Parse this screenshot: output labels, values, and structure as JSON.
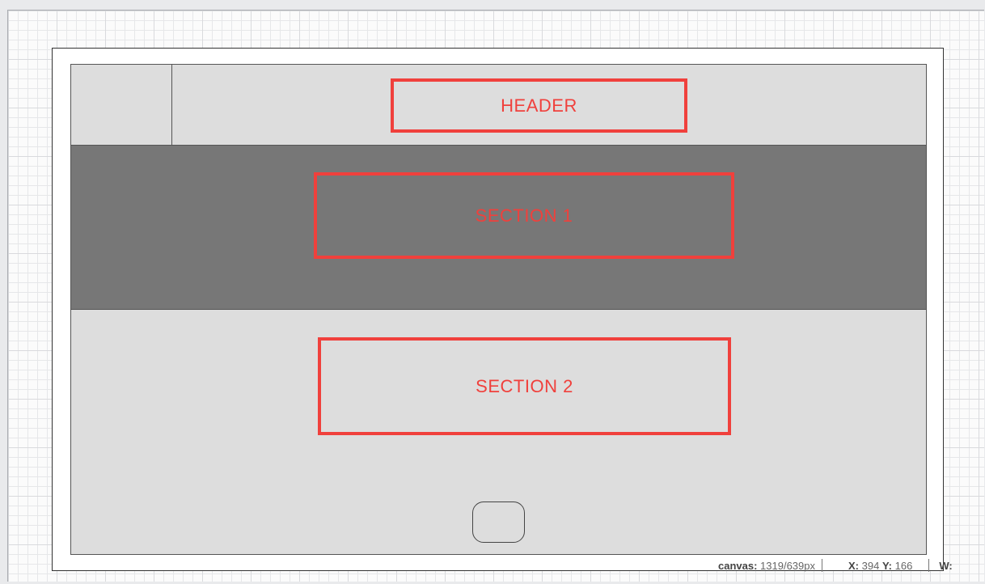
{
  "wireframe": {
    "header_label": "HEADER",
    "section1_label": "SECTION 1",
    "section2_label": "SECTION 2"
  },
  "status_bar": {
    "canvas_key": "canvas:",
    "canvas_value": "1319/639px",
    "x_key": "X:",
    "x_value": "394",
    "y_key": "Y:",
    "y_value": "166",
    "w_key": "W:"
  },
  "colors": {
    "annotation": "#f0403c",
    "section1_fill": "#777777",
    "screen_fill": "#dddddd"
  }
}
